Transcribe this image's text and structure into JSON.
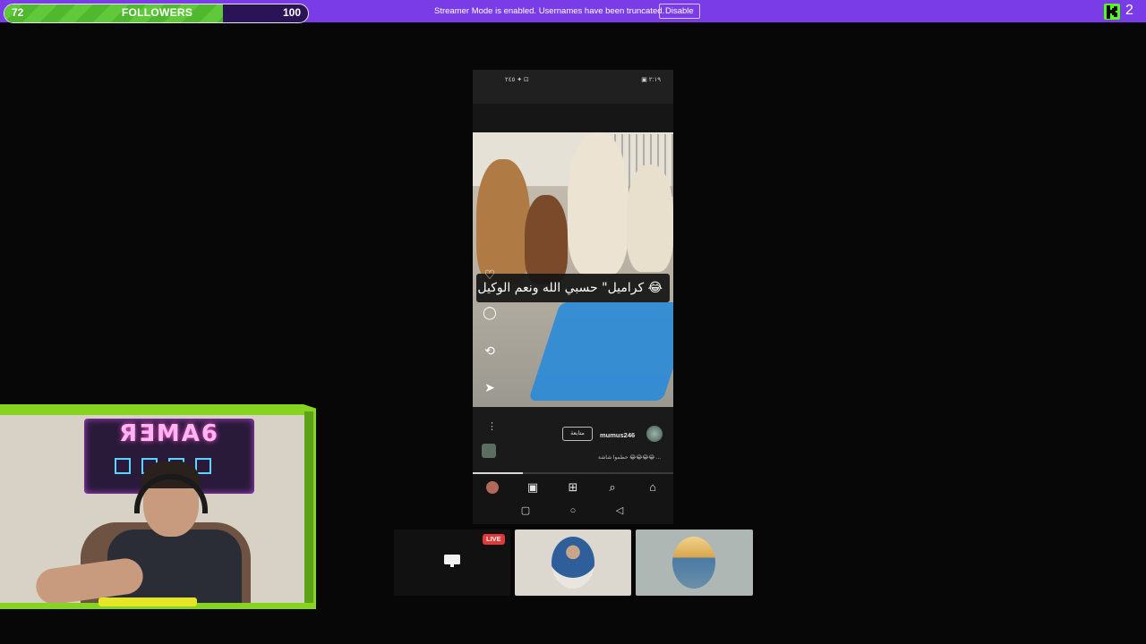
{
  "topbar": {
    "goal": {
      "current": "72",
      "label": "FOLLOWERS",
      "target": "100",
      "progress": 0.72
    },
    "streamer_notice": "Streamer Mode is enabled. Usernames have been truncated.",
    "disable_label": "Disable",
    "viewer_count": "2",
    "brand_color": "#7a3ce6",
    "goal_color": "#5fc93a"
  },
  "phone": {
    "status_left": "٢٤٥ ✦ ⊡",
    "status_right": "▣ ٢:١٩",
    "caption": "كراميل\" حسبي الله ونعم الوكيل 😂",
    "side_icons": [
      "heart-icon",
      "comment-icon",
      "repost-icon",
      "send-icon"
    ],
    "username": "mumus246",
    "follow_label": "متابعة",
    "subline": "حطموا شاشة 😂😂😂😂 ...",
    "progress": 0.25,
    "nav_icons": [
      "profile-avatar",
      "reels-icon",
      "add-icon",
      "search-icon",
      "home-icon"
    ],
    "system_icons": [
      "recent-apps-icon",
      "home-circle-icon",
      "back-icon"
    ]
  },
  "tiles": {
    "live_label": "LIVE"
  },
  "webcam": {
    "sign_text": "ЯƎMA6",
    "accent_color": "#86d41f"
  }
}
